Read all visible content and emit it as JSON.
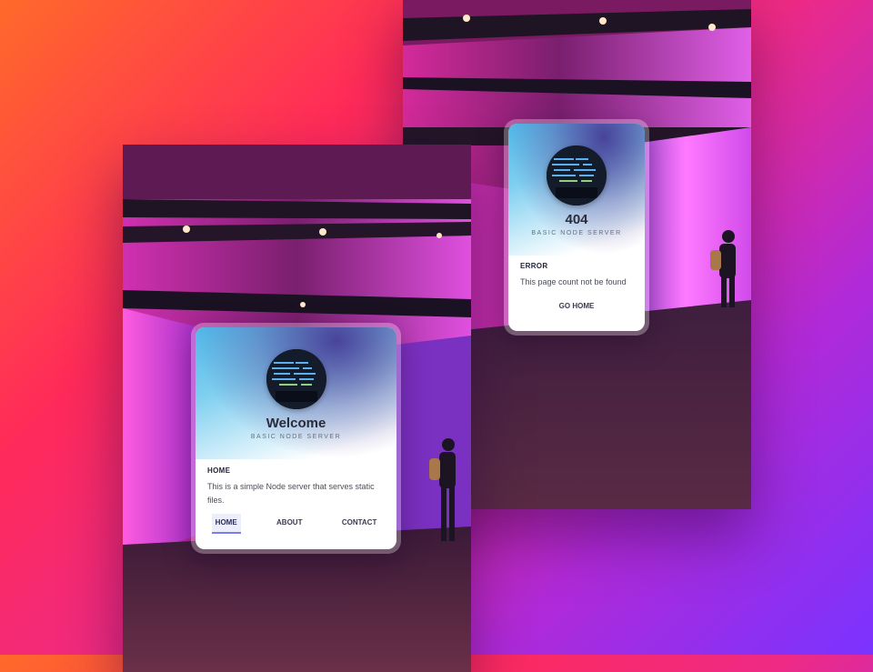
{
  "background": {
    "gradient_start": "#ff6a2a",
    "gradient_end": "#7a33ff"
  },
  "error_card": {
    "title": "404",
    "subtitle": "BASIC NODE SERVER",
    "section_label": "ERROR",
    "message": "This page count not be found",
    "action_label": "GO HOME"
  },
  "home_card": {
    "title": "Welcome",
    "subtitle": "BASIC NODE SERVER",
    "section_label": "HOME",
    "message": "This is a simple Node server that serves static files.",
    "nav": [
      {
        "label": "HOME",
        "active": true
      },
      {
        "label": "ABOUT",
        "active": false
      },
      {
        "label": "CONTACT",
        "active": false
      }
    ],
    "accent": "#7c7cf0"
  },
  "icons": [
    "code-screen-avatar"
  ]
}
